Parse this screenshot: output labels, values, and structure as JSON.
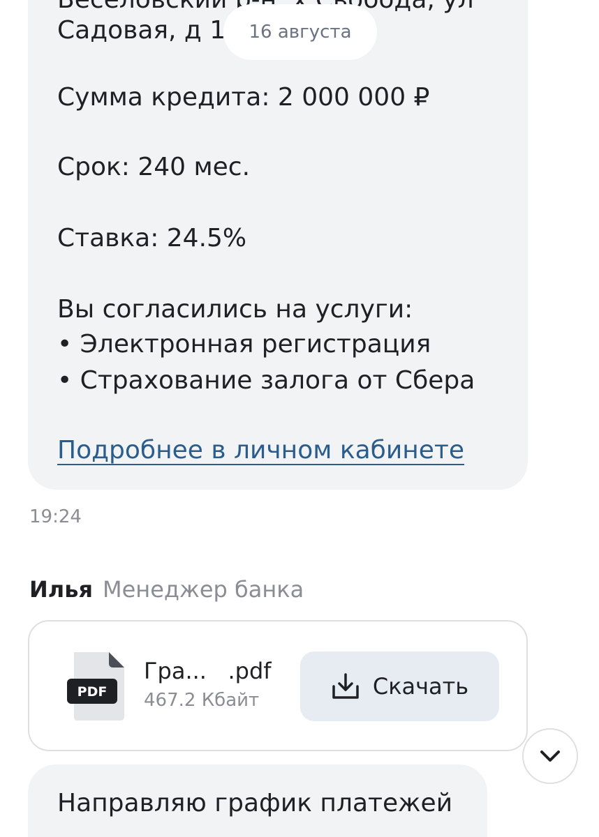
{
  "messages": {
    "credit_info": {
      "address_line_cut": "Веселовский р-н, х Свобода, ул",
      "address_line": "Садовая, д 1",
      "amount": "Сумма кредита: 2 000 000 ₽",
      "term": "Срок: 240 мес.",
      "rate": "Ставка: 24.5%",
      "services_title": "Вы согласились на услуги:",
      "services": [
        "• Электронная регистрация",
        "• Страхование залога от Сбера"
      ],
      "link": "Подробнее в личном кабинете"
    },
    "date_chip": "16 августа",
    "time": "19:24",
    "sender": {
      "name": "Илья",
      "role": "Менеджер банка"
    },
    "file": {
      "name": "Гра...   .pdf",
      "size": "467.2 Кбайт",
      "icon_label": "PDF",
      "download_label": "Скачать"
    },
    "next_message": "Направляю график платежей"
  },
  "icons": [
    "pdf-file-icon",
    "download-icon",
    "chevron-down-icon"
  ],
  "colors": {
    "bubble": "#f2f3f5",
    "link": "#2a5d8c",
    "muted": "#8a8d93",
    "button": "#e7ecf2"
  }
}
